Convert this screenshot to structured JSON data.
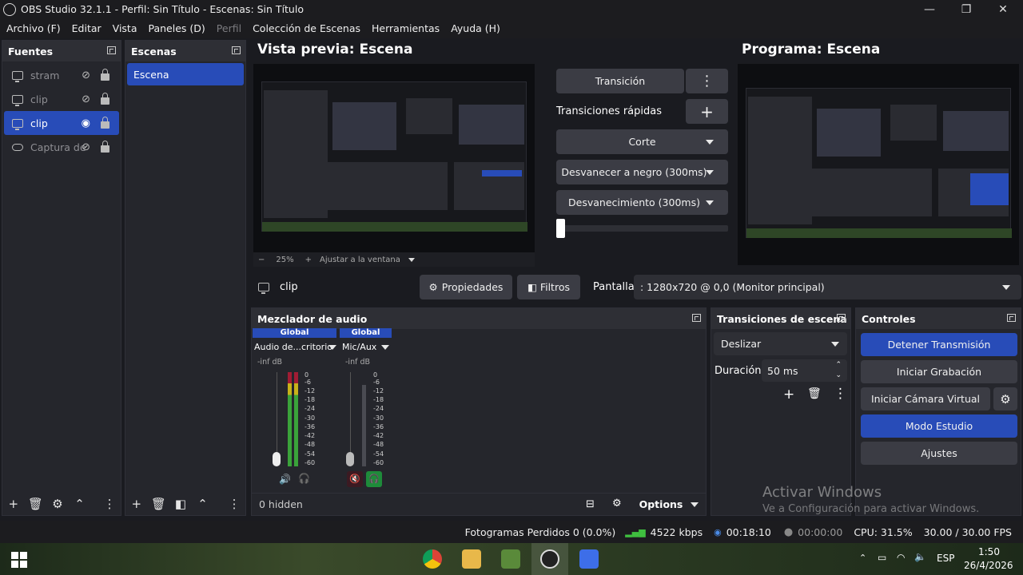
{
  "window": {
    "title": "OBS Studio 32.1.1 - Perfil: Sin Título - Escenas: Sin Título"
  },
  "menu": [
    "Archivo (F)",
    "Editar",
    "Vista",
    "Paneles (D)",
    "Perfil",
    "Colección de Escenas",
    "Herramientas",
    "Ayuda (H)"
  ],
  "sources": {
    "title": "Fuentes",
    "items": [
      {
        "label": "stram",
        "visible": false
      },
      {
        "label": "clip",
        "visible": false
      },
      {
        "label": "clip",
        "visible": true
      },
      {
        "label": "Captura de",
        "visible": false
      }
    ]
  },
  "scenes": {
    "title": "Escenas",
    "items": [
      "Escena"
    ]
  },
  "preview": {
    "title": "Vista previa: Escena",
    "zoom": "25%",
    "fit_label": "Ajustar a la ventana"
  },
  "program": {
    "title": "Programa: Escena"
  },
  "transitions_center": {
    "transition_btn": "Transición",
    "quick_label": "Transiciones rápidas",
    "items": [
      "Corte",
      "Desvanecer a negro (300ms)",
      "Desvanecimiento (300ms)"
    ]
  },
  "source_toolbar": {
    "name": "clip",
    "properties": "Propiedades",
    "filters": "Filtros",
    "display_label": "Pantalla",
    "display_value": ": 1280x720 @ 0,0 (Monitor principal)"
  },
  "mixer": {
    "title": "Mezclador de audio",
    "channels": [
      {
        "header": "Global",
        "name": "Audio de...critorio",
        "db": "-inf dB"
      },
      {
        "header": "Global",
        "name": "Mic/Aux",
        "db": "-inf dB"
      }
    ],
    "scale": [
      "0",
      "-6",
      "-12",
      "-18",
      "-24",
      "-30",
      "-36",
      "-42",
      "-48",
      "-54",
      "-60"
    ],
    "hidden_label": "0 hidden",
    "options_label": "Options"
  },
  "scene_transitions": {
    "title": "Transiciones de escena",
    "selected": "Deslizar",
    "duration_label": "Duración",
    "duration_value": "50 ms"
  },
  "controls": {
    "title": "Controles",
    "stop_stream": "Detener Transmisión",
    "start_record": "Iniciar Grabación",
    "virtual_cam": "Iniciar Cámara Virtual",
    "studio_mode": "Modo Estudio",
    "settings": "Ajustes"
  },
  "watermark": {
    "line1": "Activar Windows",
    "line2": "Ve a Configuración para activar Windows."
  },
  "status": {
    "dropped": "Fotogramas Perdidos 0 (0.0%)",
    "bitrate": "4522 kbps",
    "stream_time": "00:18:10",
    "record_time": "00:00:00",
    "cpu": "CPU: 31.5%",
    "fps": "30.00 / 30.00 FPS"
  },
  "taskbar": {
    "lang": "ESP",
    "time": "1:50",
    "date": "26/4/2026"
  },
  "colors": {
    "accent": "#284cb8",
    "bg": "#1a1b20",
    "dock": "#25262c"
  }
}
